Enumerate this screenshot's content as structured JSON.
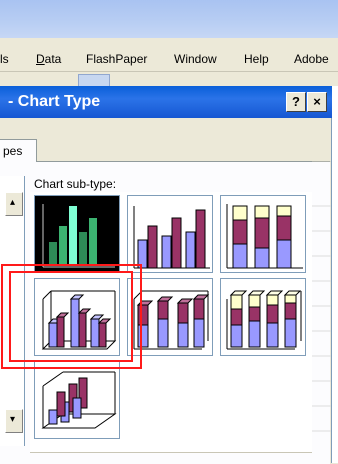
{
  "menubar": {
    "items": [
      {
        "label": "ls",
        "underline": null
      },
      {
        "label": "Data",
        "underline": "D"
      },
      {
        "label": "FlashPaper",
        "underline": "P"
      },
      {
        "label": "Window",
        "underline": "W"
      },
      {
        "label": "Help",
        "underline": "H"
      },
      {
        "label": "Adobe",
        "underline": "b"
      }
    ]
  },
  "dialog": {
    "title": "- Chart Type",
    "help_button": "?",
    "close_button": "×",
    "tab_label": "pes",
    "subtype_label": "Chart sub-type:",
    "subtypes": [
      {
        "name": "clustered-column-dark",
        "selected": false
      },
      {
        "name": "clustered-column-3d-effect",
        "selected": false
      },
      {
        "name": "stacked-column-3d-effect",
        "selected": false
      },
      {
        "name": "3d-clustered-column",
        "selected": true
      },
      {
        "name": "3d-stacked-column",
        "selected": false
      },
      {
        "name": "100-percent-stacked-3d-column",
        "selected": false
      },
      {
        "name": "3d-column",
        "selected": false
      }
    ]
  },
  "colors": {
    "title_bar": "#1657d2",
    "series_1": "#9999ff",
    "series_2": "#993366",
    "series_3": "#ffffcc",
    "highlight": "#ff1a1a"
  }
}
